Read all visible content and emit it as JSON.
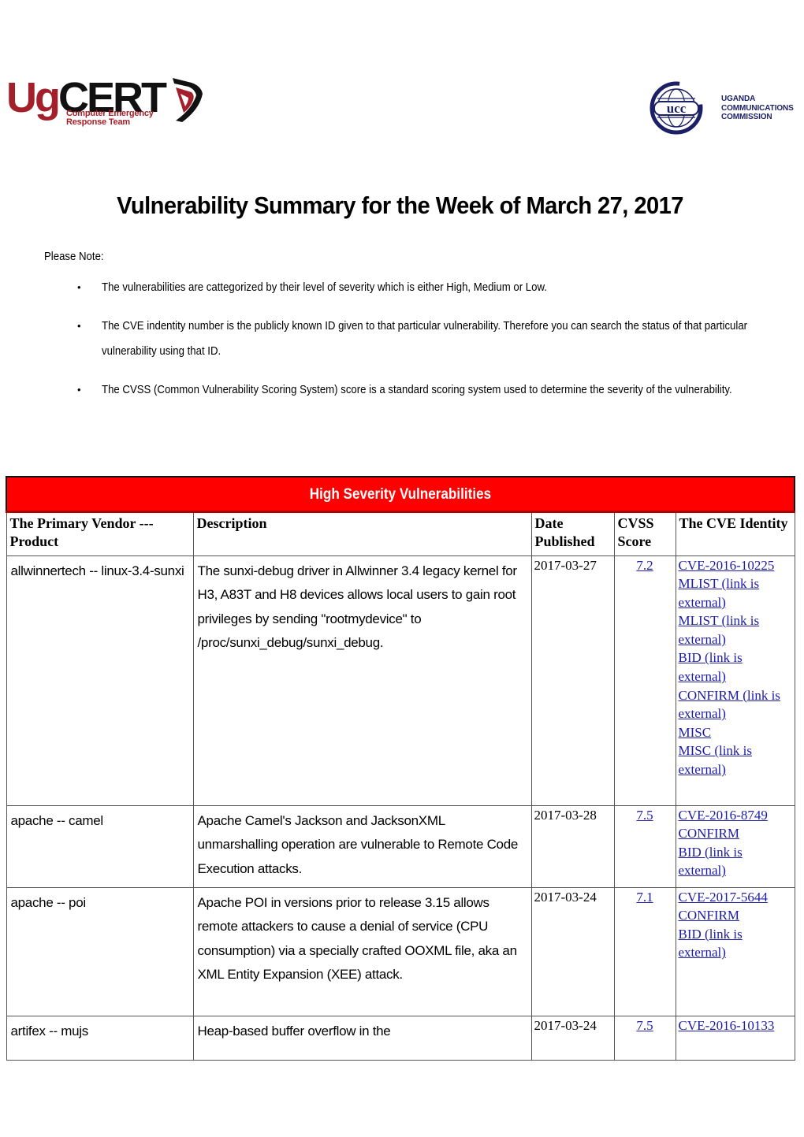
{
  "logos": {
    "left": {
      "name": "UgCERT",
      "word_ug": "Ug",
      "word_cert": "CERT",
      "subtitle_line1": "Computer Emergency",
      "subtitle_line2": "Response Team",
      "accent": "#a3202a"
    },
    "right": {
      "emblem_text": "ucc",
      "line1": "UGANDA",
      "line2": "COMMUNICATIONS",
      "line3": "COMMISSION",
      "accent": "#1b1f66"
    }
  },
  "title": "Vulnerability Summary for the Week of March 27, 2017",
  "note_label": "Please Note:",
  "notes": [
    "The vulnerabilities are cattegorized by their level of severity which is either High, Medium or Low.",
    "The CVE indentity number is the publicly known ID given to that particular vulnerability. Therefore you can search the status of that particular vulnerability using that ID.",
    "The CVSS (Common Vulnerability Scoring System) score is a standard  scoring system used to determine the severity of the vulnerability."
  ],
  "table": {
    "banner": "High Severity Vulnerabilities",
    "banner_color": "#ff0000",
    "headers": [
      "The Primary Vendor --- Product",
      "Description",
      "Date Published",
      "CVSS Score",
      "The CVE Identity"
    ],
    "rows": [
      {
        "vendor": "allwinnertech -- linux-3.4-sunxi",
        "description": "The sunxi-debug driver in Allwinner 3.4 legacy kernel for H3, A83T and H8 devices allows local users to gain root privileges by sending \"rootmydevice\" to /proc/sunxi_debug/sunxi_debug.",
        "date": "2017-03-27",
        "score": "7.2",
        "links": [
          "CVE-2016-10225",
          "MLIST (link is external)",
          "MLIST (link is external)",
          "BID (link is external)",
          "CONFIRM (link is external)",
          "MISC",
          "MISC (link is external)"
        ]
      },
      {
        "vendor": "apache -- camel",
        "description": "Apache Camel's Jackson and JacksonXML unmarshalling operation are vulnerable to Remote Code Execution attacks.",
        "date": "2017-03-28",
        "score": "7.5",
        "links": [
          "CVE-2016-8749",
          "CONFIRM",
          "BID (link is external)"
        ]
      },
      {
        "vendor": "apache -- poi",
        "description": "Apache POI in versions prior to release 3.15 allows remote attackers to cause a denial of service (CPU consumption) via a specially crafted OOXML file, aka an XML Entity Expansion (XEE) attack.",
        "date": "2017-03-24",
        "score": "7.1",
        "links": [
          "CVE-2017-5644",
          "CONFIRM",
          "BID (link is external)"
        ]
      },
      {
        "vendor": "artifex -- mujs",
        "description": "Heap-based buffer overflow in the",
        "date": "2017-03-24",
        "score": "7.5",
        "links": [
          "CVE-2016-10133"
        ]
      }
    ]
  }
}
